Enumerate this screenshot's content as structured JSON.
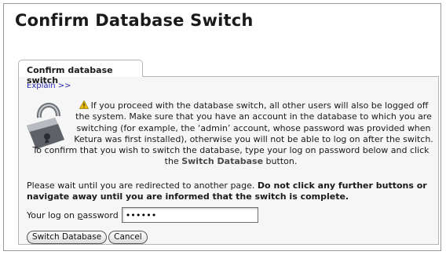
{
  "page": {
    "title": "Confirm Database Switch"
  },
  "tab": {
    "label": "Confirm database switch"
  },
  "panel": {
    "explain_link": "Explain >>",
    "warning_icon": "warning-triangle-icon",
    "lock_icon": "padlock-icon",
    "paragraph1_part1": "If you proceed with the database switch, all other users will also be logged off the system. Make sure that you have an account in the database to which you are switching (for example, the ‘admin’ account, whose password was provided when Ketura was first installed), otherwise you will not be able to log on after the switch. To confirm that you wish to switch the database, type your log on password below and click the ",
    "paragraph1_bold": "Switch Database",
    "paragraph1_part2": " button.",
    "paragraph2_part1": "Please wait until you are redirected to another page. ",
    "paragraph2_bold": "Do not click any further buttons or navigate away until you are informed that the switch is complete.",
    "password_label_pre": "Your log on ",
    "password_label_access": "p",
    "password_label_post": "assword",
    "password_value": "••••••",
    "switch_button": "Switch Database",
    "cancel_button": "Cancel"
  },
  "colors": {
    "link": "#2b2bb0",
    "panel_bg": "#f6f6f6",
    "border": "#b5b5b5",
    "warning": "#f2c200"
  }
}
